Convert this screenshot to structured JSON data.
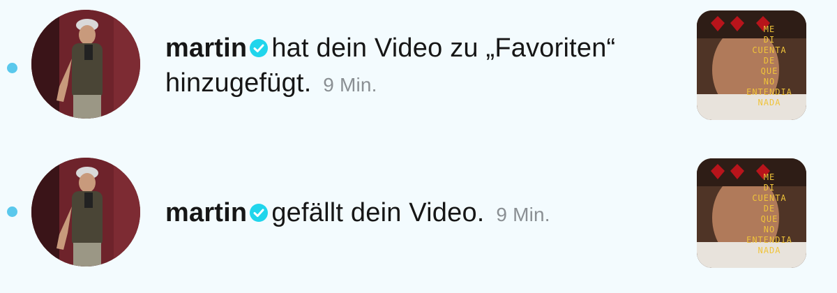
{
  "notifications": [
    {
      "username": "martin",
      "message": "hat dein Video zu „Favoriten“ hinzugefügt.",
      "time": "9 Min.",
      "thumbnail_text": [
        "ME",
        "DI",
        "CUENTA",
        "DE",
        "QUE",
        "NO",
        "ENTENDIA",
        "NADA"
      ]
    },
    {
      "username": "martin",
      "message": "gefällt dein Video.",
      "time": "9 Min.",
      "thumbnail_text": [
        "ME",
        "DI",
        "CUENTA",
        "DE",
        "QUE",
        "NO",
        "ENTENDIA",
        "NADA"
      ]
    }
  ],
  "colors": {
    "background": "#f3fbfe",
    "unread_dot": "#5ac8ec",
    "verified_badge": "#20d5ec",
    "text": "#161616",
    "time": "#8a8f93",
    "thumbnail_text": "#f0c43a"
  },
  "icons": {
    "unread": "unread-dot",
    "verified": "verified-badge-icon"
  }
}
